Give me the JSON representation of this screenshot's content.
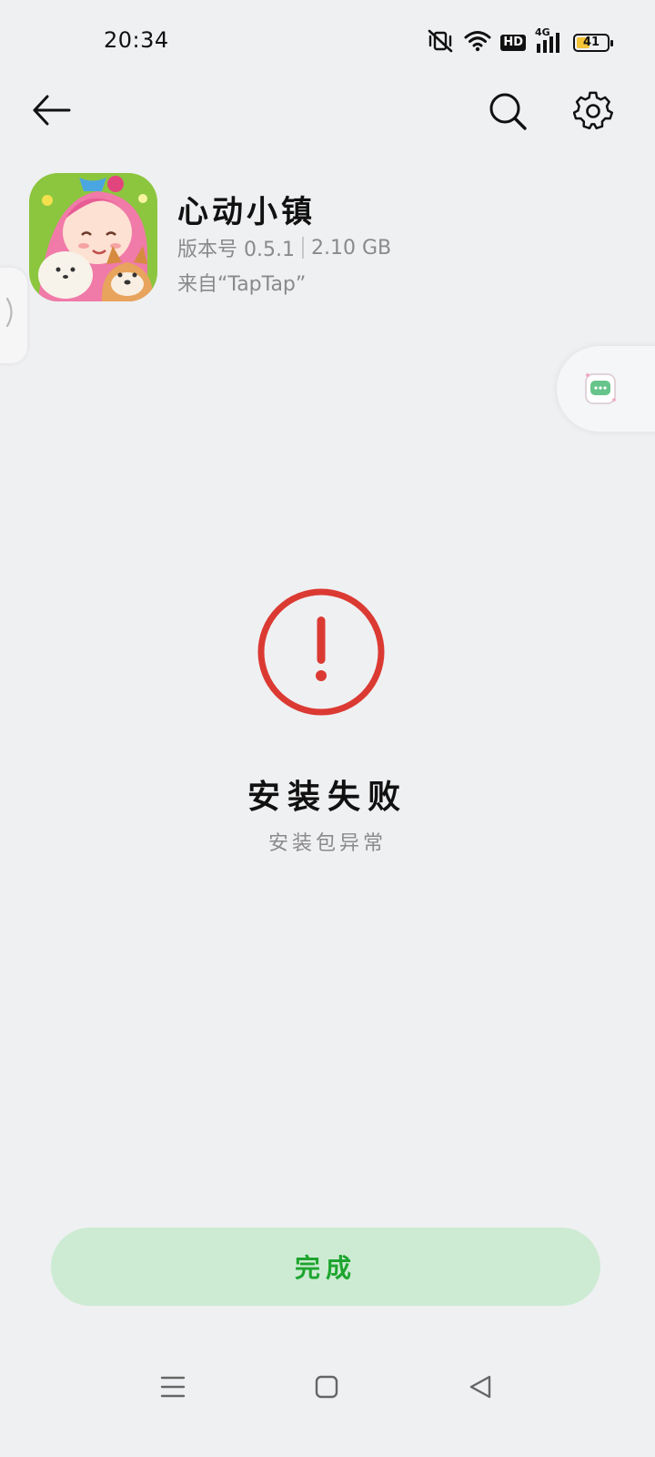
{
  "status_bar": {
    "time": "20:34",
    "icons": [
      "mute-vibrate-icon",
      "wifi-icon",
      "hd-icon",
      "cell-signal-icon",
      "battery-icon"
    ],
    "hd_label": "HD",
    "network_type": "4G",
    "battery_level": "41"
  },
  "top_bar": {
    "back_icon": "arrow-left-icon",
    "search_icon": "search-icon",
    "settings_icon": "gear-icon"
  },
  "app": {
    "name": "心动小镇",
    "version_label": "版本号 0.5.1",
    "size": "2.10 GB",
    "source": "来自“TapTap”"
  },
  "result": {
    "icon": "error-exclamation-icon",
    "status_color": "#db3a33",
    "title": "安装失败",
    "subtitle": "安装包异常"
  },
  "actions": {
    "done_label": "完成",
    "done_color": "#1ea52f"
  },
  "nav_bar": {
    "menu_icon": "menu-icon",
    "home_icon": "home-square-icon",
    "back_icon": "back-triangle-icon"
  }
}
